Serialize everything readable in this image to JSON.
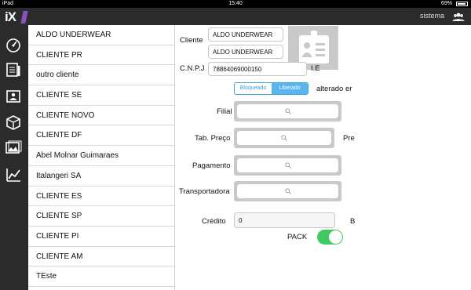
{
  "status": {
    "device": "iPad",
    "time": "15:40",
    "battery": "69%"
  },
  "navbar": {
    "logo": "iX",
    "user_label": "sistema"
  },
  "sidebar_icons": [
    "speedometer-icon",
    "document-icon",
    "contact-card-icon",
    "box-icon",
    "images-icon",
    "chart-icon"
  ],
  "clients": [
    "ALDO UNDERWEAR",
    "CLIENTE PR",
    "outro cliente",
    "CLIENTE SE",
    "CLIENTE NOVO",
    "CLIENTE DF",
    "Abel Molnar Guimaraes",
    "Italangeri SA",
    "CLIENTE ES",
    "CLIENTE SP",
    "CLIENTE PI",
    "CLIENTE AM",
    "TEste"
  ],
  "form": {
    "cliente_label": "Cliente",
    "cliente_name_1": "ALDO UNDERWEAR",
    "cliente_name_2": "ALDO UNDERWEAR",
    "cnpj_label": "C.N.P.J",
    "cnpj_value": "78864069000150",
    "ie_label": "I.E",
    "seg_bloqueado": "Bloqueado",
    "seg_liberado": "Liberado",
    "alterado_label": "alterado er",
    "filial_label": "Filial",
    "tab_preco_label": "Tab. Preço",
    "pre_label": "Pre",
    "pagamento_label": "Pagamento",
    "transportadora_label": "Transportadora",
    "credito_label": "Crédito",
    "credito_value": "0",
    "b_label": "B",
    "pack_label": "PACK",
    "pack_on": true
  },
  "colors": {
    "accent": "#5ab5ee",
    "toggle": "#3fcb61",
    "logo_bar": "#8b4fc1",
    "dark": "#2b2b2b"
  }
}
